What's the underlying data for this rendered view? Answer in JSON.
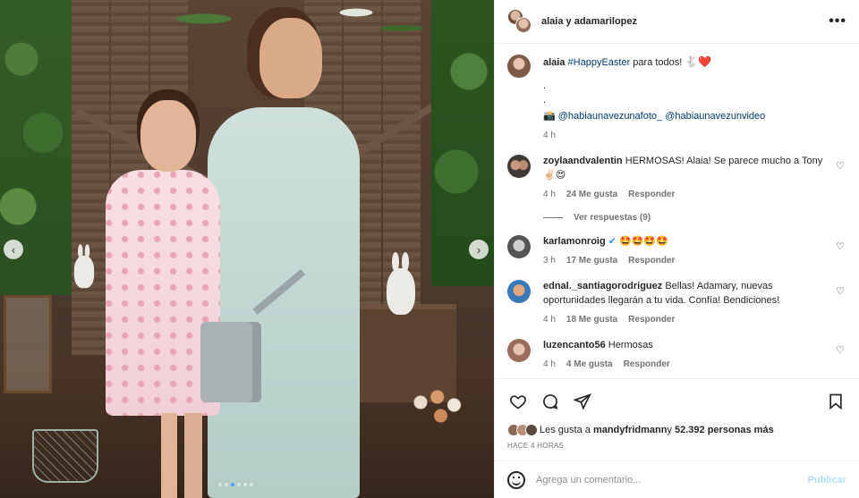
{
  "post": {
    "header_title": "alaia y adamarilopez",
    "more_icon": "more-horizontal-icon",
    "carousel": {
      "prev_icon": "chevron-left-icon",
      "next_icon": "chevron-right-icon",
      "prev_glyph": "‹",
      "next_glyph": "›",
      "slide_count": 6,
      "active_slide": 1
    }
  },
  "caption": {
    "username": "alaia",
    "hashtag": "#HappyEaster",
    "text": " para todos! ",
    "emoji": "🐇❤️",
    "dot1": ".",
    "dot2": ".",
    "camera_emoji": "📸",
    "mention1": "@habiaunavezunafoto_",
    "mention2": "@habiaunavezunvideo",
    "time": "4 h"
  },
  "comments": [
    {
      "username": "zoylaandvalentin",
      "text": "HERMOSAS! Alaia! Se parece mucho a Tony",
      "emoji": "✌🏻😍",
      "time": "4 h",
      "likes": "24 Me gusta",
      "reply": "Responder",
      "view_replies": "Ver respuestas (9)"
    },
    {
      "username": "karlamonroig",
      "verified": "✔",
      "text": "",
      "emoji": "🤩🤩🤩🤩",
      "time": "3 h",
      "likes": "17 Me gusta",
      "reply": "Responder"
    },
    {
      "username": "ednal._santiagorodriguez",
      "text": "Bellas! Adamary, nuevas oportunidades llegarán a tu vida. Confía! Bendiciones!",
      "emoji": "",
      "time": "4 h",
      "likes": "18 Me gusta",
      "reply": "Responder"
    },
    {
      "username": "luzencanto56",
      "text": "Hermosas",
      "emoji": "",
      "time": "4 h",
      "likes": "4 Me gusta",
      "reply": "Responder"
    }
  ],
  "actions": {
    "like_icon": "heart-icon",
    "comment_icon": "comment-icon",
    "share_icon": "send-icon",
    "save_icon": "bookmark-icon"
  },
  "likes": {
    "prefix": "Les gusta a ",
    "user": "mandyfridmann",
    "middle": " y ",
    "count": "52.392 personas más"
  },
  "timeago": "HACE 4 HORAS",
  "composer": {
    "placeholder": "Agrega un comentario...",
    "publish_label": "Publicar",
    "emoji_icon": "smile-icon"
  }
}
